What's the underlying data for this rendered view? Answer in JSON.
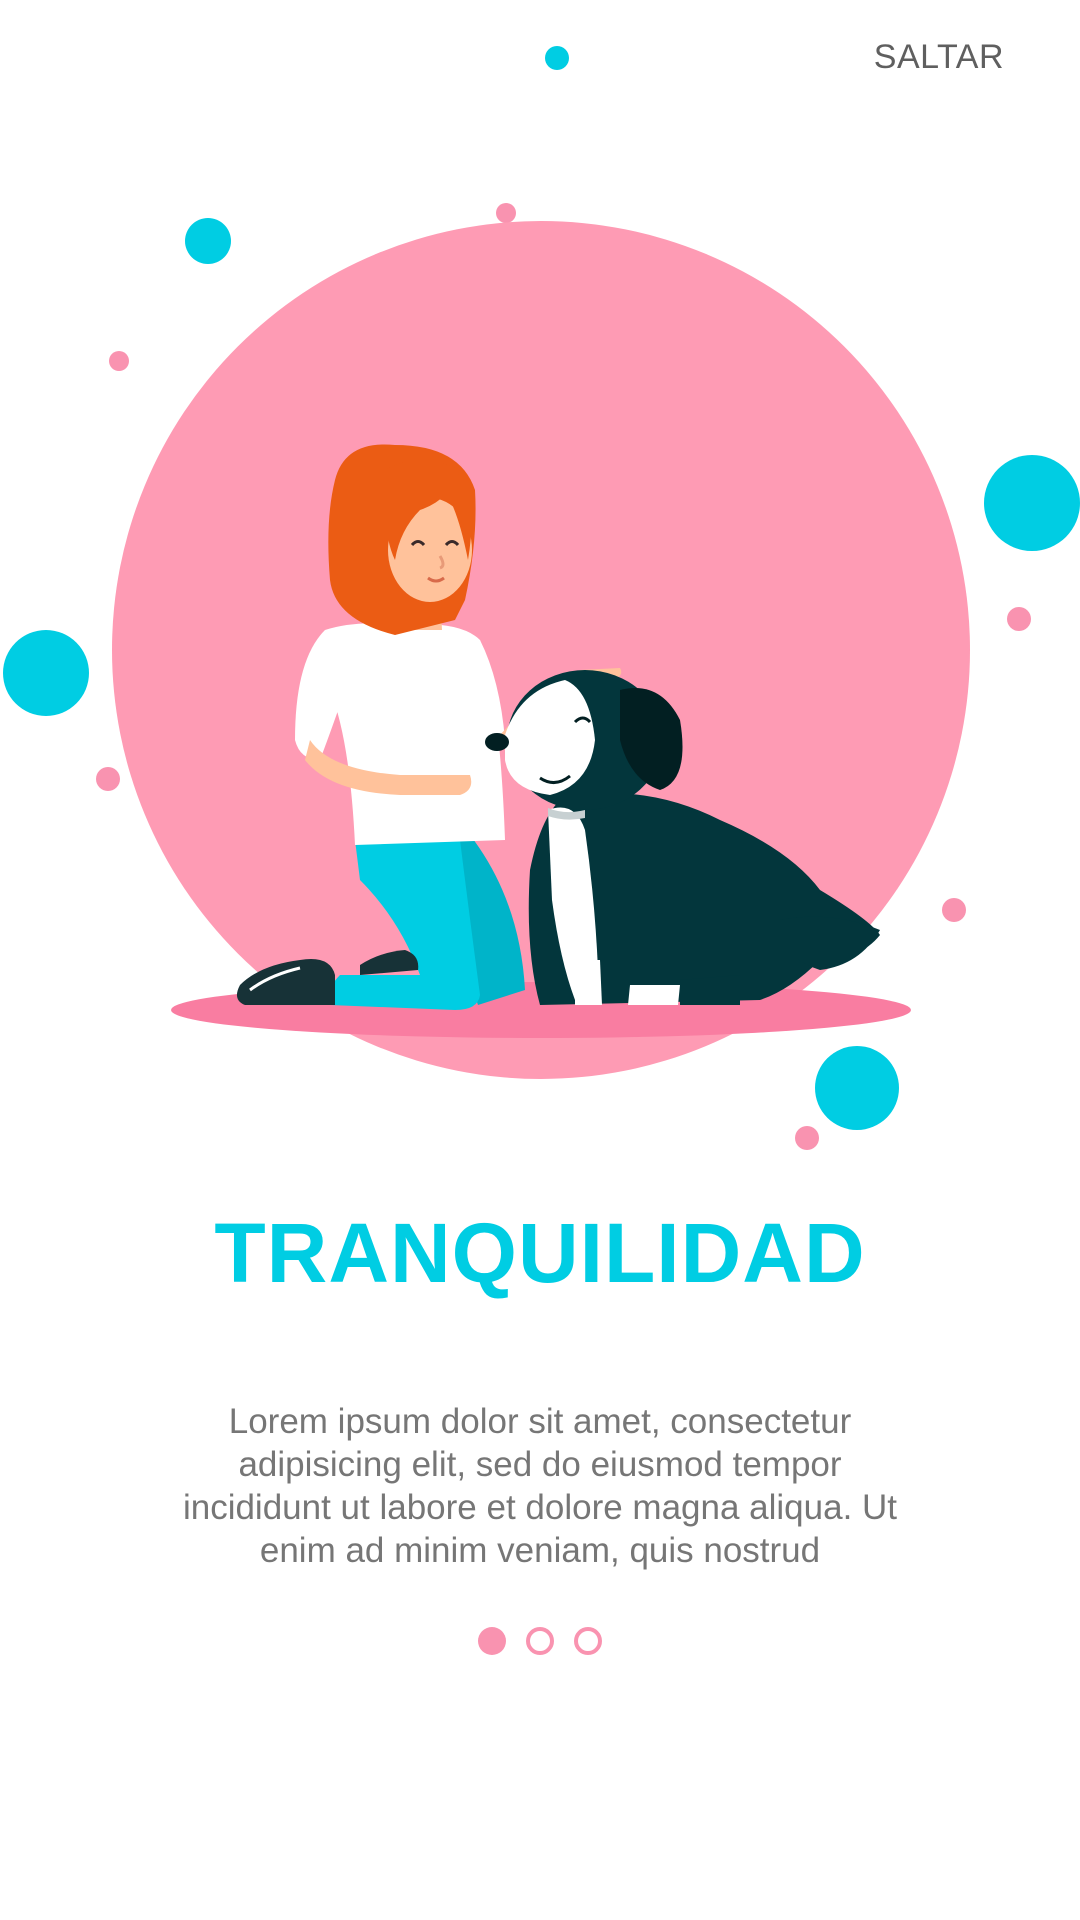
{
  "header": {
    "skip_label": "SALTAR"
  },
  "onboarding": {
    "title": "TRANQUILIDAD",
    "description": "Lorem ipsum dolor sit amet, consectetur adipisicing elit, sed do eiusmod tempor incididunt ut labore et dolore magna aliqua. Ut enim ad minim veniam, quis nostrud",
    "page_indicator": {
      "total": 3,
      "current": 1
    }
  },
  "colors": {
    "accent": "#00cde3",
    "pink": "#f993b0",
    "text_secondary": "#767676",
    "text_skip": "#5f5f5f"
  },
  "illustration": {
    "icon": "woman-petting-dog-illustration"
  }
}
